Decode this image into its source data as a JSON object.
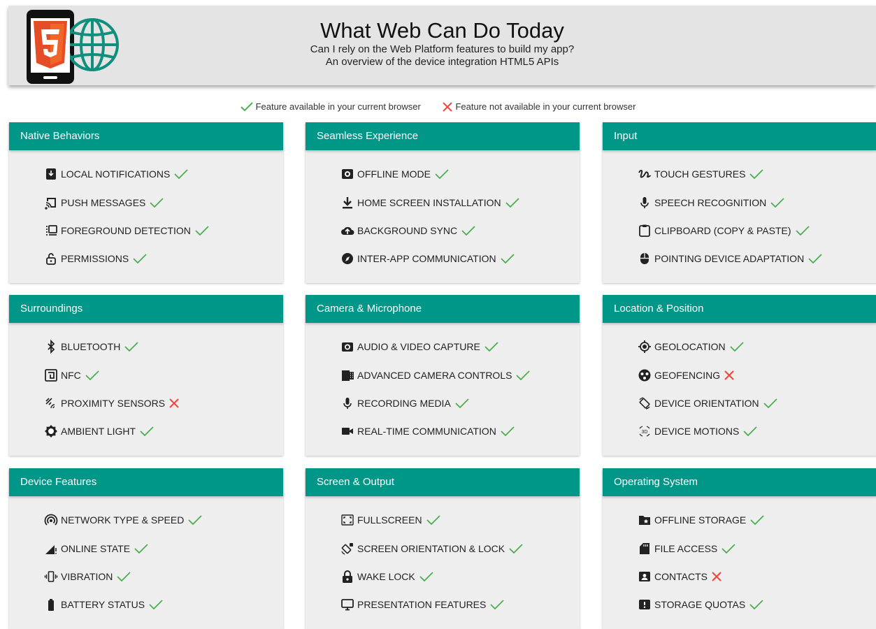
{
  "header": {
    "title": "What Web Can Do Today",
    "subtitle_1": "Can I rely on the Web Platform features to build my app?",
    "subtitle_2": "An overview of the device integration HTML5 APIs",
    "logo_icon": "html5-phone-globe-logo"
  },
  "legend": {
    "available": "Feature available in your current browser",
    "unavailable": "Feature not available in your current browser"
  },
  "colors": {
    "accent": "#009688",
    "available": "#4caf50",
    "unavailable": "#f44336",
    "logo_orange": "#e44d26"
  },
  "cards": [
    {
      "title": "Native Behaviors",
      "features": [
        {
          "label": "LOCAL NOTIFICATIONS",
          "icon": "notification-icon",
          "available": true
        },
        {
          "label": "PUSH MESSAGES",
          "icon": "cast-icon",
          "available": true
        },
        {
          "label": "FOREGROUND DETECTION",
          "icon": "foreground-icon",
          "available": true
        },
        {
          "label": "PERMISSIONS",
          "icon": "unlock-icon",
          "available": true
        }
      ]
    },
    {
      "title": "Seamless Experience",
      "features": [
        {
          "label": "OFFLINE MODE",
          "icon": "offline-icon",
          "available": true
        },
        {
          "label": "HOME SCREEN INSTALLATION",
          "icon": "download-icon",
          "available": true
        },
        {
          "label": "BACKGROUND SYNC",
          "icon": "cloud-upload-icon",
          "available": true
        },
        {
          "label": "INTER-APP COMMUNICATION",
          "icon": "compass-icon",
          "available": true
        }
      ]
    },
    {
      "title": "Input",
      "features": [
        {
          "label": "TOUCH GESTURES",
          "icon": "gesture-icon",
          "available": true
        },
        {
          "label": "SPEECH RECOGNITION",
          "icon": "mic-icon",
          "available": true
        },
        {
          "label": "CLIPBOARD (COPY & PASTE)",
          "icon": "clipboard-icon",
          "available": true
        },
        {
          "label": "POINTING DEVICE ADAPTATION",
          "icon": "mouse-icon",
          "available": true
        }
      ]
    },
    {
      "title": "Surroundings",
      "features": [
        {
          "label": "BLUETOOTH",
          "icon": "bluetooth-icon",
          "available": true
        },
        {
          "label": "NFC",
          "icon": "nfc-icon",
          "available": true
        },
        {
          "label": "PROXIMITY SENSORS",
          "icon": "proximity-icon",
          "available": false
        },
        {
          "label": "AMBIENT LIGHT",
          "icon": "brightness-icon",
          "available": true
        }
      ]
    },
    {
      "title": "Camera & Microphone",
      "features": [
        {
          "label": "AUDIO & VIDEO CAPTURE",
          "icon": "camera-icon",
          "available": true
        },
        {
          "label": "ADVANCED CAMERA CONTROLS",
          "icon": "camera-roll-icon",
          "available": true
        },
        {
          "label": "RECORDING MEDIA",
          "icon": "mic-icon",
          "available": true
        },
        {
          "label": "REAL-TIME COMMUNICATION",
          "icon": "videocam-icon",
          "available": true
        }
      ]
    },
    {
      "title": "Location & Position",
      "features": [
        {
          "label": "GEOLOCATION",
          "icon": "my-location-icon",
          "available": true
        },
        {
          "label": "GEOFENCING",
          "icon": "geofence-icon",
          "available": false
        },
        {
          "label": "DEVICE ORIENTATION",
          "icon": "screen-rotation-icon",
          "available": true
        },
        {
          "label": "DEVICE MOTIONS",
          "icon": "3d-rotation-icon",
          "available": true
        }
      ]
    },
    {
      "title": "Device Features",
      "features": [
        {
          "label": "NETWORK TYPE & SPEED",
          "icon": "wifi-tethering-icon",
          "available": true
        },
        {
          "label": "ONLINE STATE",
          "icon": "signal-icon",
          "available": true
        },
        {
          "label": "VIBRATION",
          "icon": "vibration-icon",
          "available": true
        },
        {
          "label": "BATTERY STATUS",
          "icon": "battery-icon",
          "available": true
        }
      ]
    },
    {
      "title": "Screen & Output",
      "features": [
        {
          "label": "FULLSCREEN",
          "icon": "fullscreen-icon",
          "available": true
        },
        {
          "label": "SCREEN ORIENTATION & LOCK",
          "icon": "screen-lock-rotation-icon",
          "available": true
        },
        {
          "label": "WAKE LOCK",
          "icon": "lock-icon",
          "available": true
        },
        {
          "label": "PRESENTATION FEATURES",
          "icon": "monitor-icon",
          "available": true
        }
      ]
    },
    {
      "title": "Operating System",
      "features": [
        {
          "label": "OFFLINE STORAGE",
          "icon": "folder-star-icon",
          "available": true
        },
        {
          "label": "FILE ACCESS",
          "icon": "sd-card-icon",
          "available": true
        },
        {
          "label": "CONTACTS",
          "icon": "contact-icon",
          "available": false
        },
        {
          "label": "STORAGE QUOTAS",
          "icon": "storage-alert-icon",
          "available": true
        }
      ]
    }
  ]
}
